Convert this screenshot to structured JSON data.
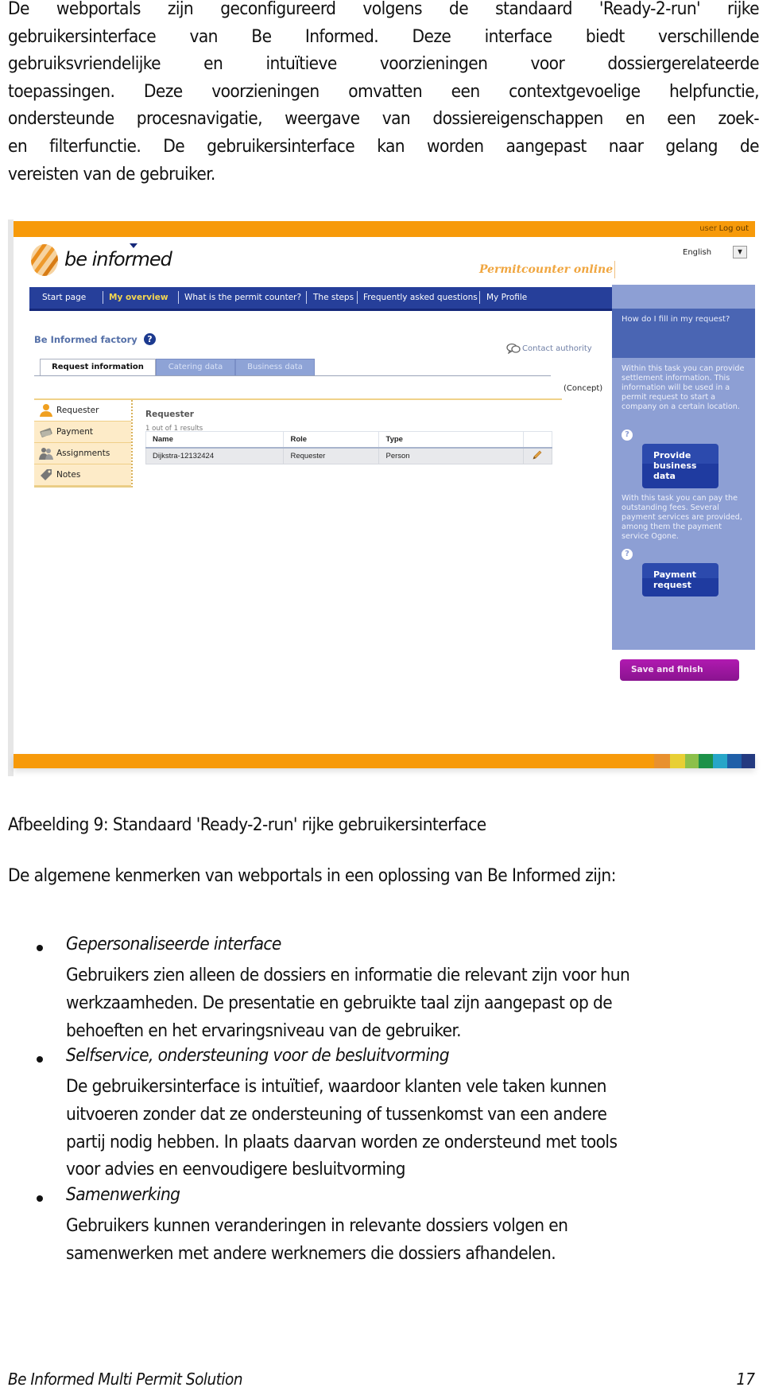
{
  "intro_paragraph": {
    "lines": [
      "De webportals zijn geconfigureerd volgens de standaard 'Ready-2-run' rijke",
      "gebruikersinterface van Be Informed. Deze interface biedt verschillende",
      "gebruiksvriendelijke en intuïtieve voorzieningen voor dossiergerelateerde",
      "toepassingen. Deze voorzieningen omvatten een contextgevoelige helpfunctie,",
      "ondersteunde procesnavigatie, weergave van dossiereigenschappen en een zoek-",
      "en filterfunctie. De gebruikersinterface kan worden aangepast naar gelang de",
      "vereisten van de gebruiker."
    ]
  },
  "screenshot": {
    "topbar": {
      "user": "user",
      "logout": "Log out"
    },
    "logo": {
      "text": "be informed"
    },
    "language": {
      "selected": "English",
      "dropdown_glyph": "▼"
    },
    "brand_title": "Permitcounter online",
    "nav": {
      "items": [
        {
          "label": "Start page",
          "active": false
        },
        {
          "label": "My overview",
          "active": true
        },
        {
          "label": "What is the permit counter?",
          "active": false
        },
        {
          "label": "The steps",
          "active": false
        },
        {
          "label": "Frequently asked questions",
          "active": false
        },
        {
          "label": "My Profile",
          "active": false
        }
      ]
    },
    "factory_title": "Be Informed factory",
    "help_glyph": "?",
    "tabs": [
      {
        "label": "Request information",
        "active": true
      },
      {
        "label": "Catering data",
        "active": false
      },
      {
        "label": "Business data",
        "active": false
      }
    ],
    "contact_link": "Contact authority",
    "status": "(Concept)",
    "side_menu": [
      {
        "label": "Requester",
        "icon": "person-icon",
        "active": true
      },
      {
        "label": "Payment",
        "icon": "money-icon",
        "active": false
      },
      {
        "label": "Assignments",
        "icon": "people-icon",
        "active": false
      },
      {
        "label": "Notes",
        "icon": "tag-icon",
        "active": false
      }
    ],
    "section_title": "Requester",
    "result_count": "1 out of 1 results",
    "table": {
      "columns": [
        "Name",
        "Role",
        "Type",
        ""
      ],
      "rows": [
        {
          "name": "Dijkstra-12132424",
          "role": "Requester",
          "type": "Person"
        }
      ]
    },
    "help_panel": {
      "heading": "How do I fill in my request?",
      "text_1": "Within this task you can provide settlement information. This information will be used in a permit request to start a company on a certain location.",
      "button_1": "Provide business data",
      "text_2": "With this task you can pay the outstanding fees. Several payment services are provided, among them the payment service Ogone.",
      "button_2": "Payment request"
    },
    "save_button": "Save and finish",
    "colors": {
      "orange": "#f79a0a",
      "nav_blue": "#263f9a",
      "help_panel": "#8d9fd4",
      "save_purple": "#a017a4"
    },
    "footer_colors": [
      "#f79a0a",
      "#e8912e",
      "#e8cf34",
      "#8cc04a",
      "#1d9148",
      "#27a6c8",
      "#1f5fa8",
      "#243a80"
    ]
  },
  "caption": "Afbeelding 9: Standaard 'Ready-2-run' rijke gebruikersinterface",
  "features_intro": "De algemene kenmerken van webportals in een oplossing van Be Informed zijn:",
  "features": [
    {
      "title": "Gepersonaliseerde interface",
      "lines": [
        "Gebruikers zien alleen de dossiers en informatie die relevant zijn voor hun",
        "werkzaamheden. De presentatie en gebruikte taal zijn aangepast op de",
        "behoeften en het ervaringsniveau van de gebruiker."
      ]
    },
    {
      "title": "Selfservice, ondersteuning voor de besluitvorming",
      "lines": [
        "De gebruikersinterface is intuïtief, waardoor klanten vele taken kunnen",
        "uitvoeren zonder dat ze ondersteuning of tussenkomst van een andere",
        "partij nodig hebben. In plaats daarvan worden ze ondersteund met tools",
        "voor advies en eenvoudigere besluitvorming"
      ]
    },
    {
      "title": "Samenwerking",
      "lines": [
        "Gebruikers kunnen veranderingen in relevante dossiers volgen en",
        "samenwerken met andere werknemers die dossiers afhandelen."
      ]
    }
  ],
  "footer": {
    "title": "Be Informed Multi Permit Solution",
    "page_number": "17"
  }
}
